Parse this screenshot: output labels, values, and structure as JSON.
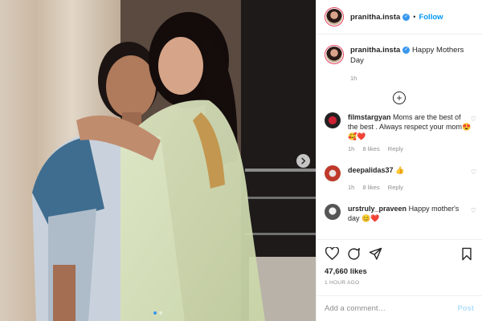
{
  "header": {
    "username": "pranitha.insta",
    "verified_glyph": "✓",
    "separator": "•",
    "follow_label": "Follow"
  },
  "caption": {
    "username": "pranitha.insta",
    "text": "Happy Mothers Day",
    "time": "1h"
  },
  "load_more_glyph": "+",
  "comments": [
    {
      "username": "filmstargyan",
      "text": "Moms are the best of the best . Always respect your mom😍🥰❤️",
      "time": "1h",
      "likes": "8 likes",
      "reply": "Reply"
    },
    {
      "username": "deepalidas37",
      "text": "👍",
      "time": "1h",
      "likes": "8 likes",
      "reply": "Reply"
    },
    {
      "username": "urstruly_praveen",
      "text": "Happy mother's day 😊❤️"
    }
  ],
  "likes_count": "47,660 likes",
  "timestamp": "1 HOUR AGO",
  "add_comment": {
    "placeholder": "Add a comment…",
    "post_label": "Post"
  },
  "icons": {
    "like": "heart-icon",
    "comment": "comment-icon",
    "share": "share-icon",
    "save": "bookmark-icon",
    "next": "chevron-right-icon"
  },
  "colors": {
    "link": "#0095f6",
    "verified": "#3897f0",
    "muted": "#8e8e8e",
    "text": "#262626"
  }
}
